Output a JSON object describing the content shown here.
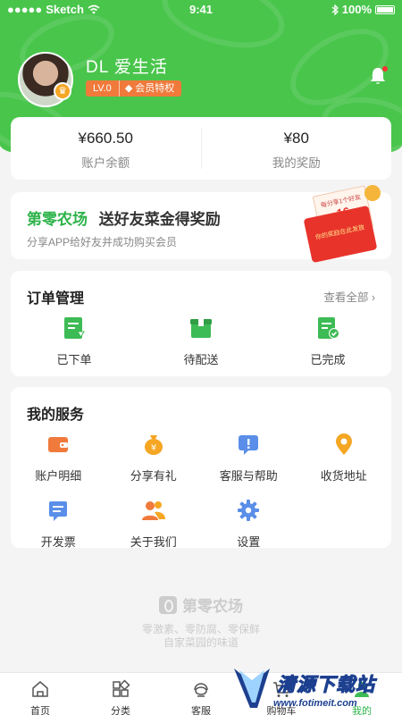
{
  "status_bar": {
    "carrier": "Sketch",
    "time": "9:41",
    "battery": "100%"
  },
  "colors": {
    "brand_green": "#49c54c",
    "accent_orange": "#f07a3c",
    "promo_green": "#2db34a"
  },
  "profile": {
    "name": "DL 爱生活",
    "level": "LV.0",
    "vip_label": "会员特权"
  },
  "balance": {
    "account": {
      "amount": "¥660.50",
      "label": "账户余额"
    },
    "reward": {
      "amount": "¥80",
      "label": "我的奖励"
    }
  },
  "promo": {
    "brand": "第零农场",
    "headline": "送好友菜金得奖励",
    "sub": "分享APP给好友并成功购买会员",
    "envelope_line1": "每分享1个好友",
    "envelope_amount": "16",
    "envelope_line2": "你的奖励在此发放"
  },
  "orders": {
    "title": "订单管理",
    "more": "查看全部",
    "items": [
      {
        "label": "已下单",
        "icon": "order-placed-icon"
      },
      {
        "label": "待配送",
        "icon": "box-icon"
      },
      {
        "label": "已完成",
        "icon": "completed-icon"
      }
    ]
  },
  "services": {
    "title": "我的服务",
    "items": [
      {
        "label": "账户明细",
        "icon": "wallet-icon"
      },
      {
        "label": "分享有礼",
        "icon": "money-bag-icon"
      },
      {
        "label": "客服与帮助",
        "icon": "help-chat-icon"
      },
      {
        "label": "收货地址",
        "icon": "location-pin-icon"
      },
      {
        "label": "开发票",
        "icon": "invoice-icon"
      },
      {
        "label": "关于我们",
        "icon": "team-icon"
      },
      {
        "label": "设置",
        "icon": "settings-gear-icon"
      }
    ]
  },
  "brand_footer": {
    "name": "第零农场",
    "slogan1": "零激素、零防腐、零保鲜",
    "slogan2": "自家菜园的味道"
  },
  "tabbar": [
    {
      "label": "首页",
      "icon": "home-icon"
    },
    {
      "label": "分类",
      "icon": "category-icon"
    },
    {
      "label": "客服",
      "icon": "customer-service-icon"
    },
    {
      "label": "购物车",
      "icon": "cart-icon"
    },
    {
      "label": "我的",
      "icon": "profile-icon"
    }
  ],
  "watermark": {
    "title": "清源下载站",
    "url": "www.fotimeit.com"
  }
}
